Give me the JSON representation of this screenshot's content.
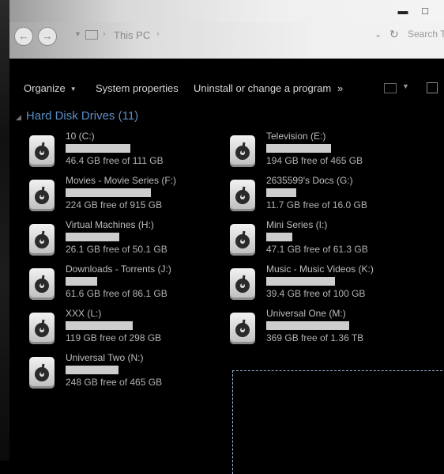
{
  "address": {
    "crumb": "This PC",
    "search_placeholder": "Search This PC"
  },
  "window": {
    "minimize": "▬",
    "maximize": "□"
  },
  "toolbar": {
    "organize": "Organize",
    "system_properties": "System properties",
    "uninstall": "Uninstall or change a program",
    "more": "»"
  },
  "group": {
    "title": "Hard Disk Drives (11)"
  },
  "drives": [
    {
      "name": "10 (C:)",
      "free": "46.4 GB free of 111 GB",
      "fill_fraction": 0.58
    },
    {
      "name": "Television (E:)",
      "free": "194 GB free of 465 GB",
      "fill_fraction": 0.58
    },
    {
      "name": "Movies - Movie Series (F:)",
      "free": "224 GB free of 915 GB",
      "fill_fraction": 0.76
    },
    {
      "name": "2635599's Docs (G:)",
      "free": "11.7 GB free of 16.0 GB",
      "fill_fraction": 0.27
    },
    {
      "name": "Virtual Machines (H:)",
      "free": "26.1 GB free of 50.1 GB",
      "fill_fraction": 0.48
    },
    {
      "name": "Mini Series (I:)",
      "free": "47.1 GB free of 61.3 GB",
      "fill_fraction": 0.23
    },
    {
      "name": "Downloads - Torrents (J:)",
      "free": "61.6 GB free of 86.1 GB",
      "fill_fraction": 0.28
    },
    {
      "name": "Music - Music Videos (K:)",
      "free": "39.4 GB free of 100 GB",
      "fill_fraction": 0.61
    },
    {
      "name": "XXX (L:)",
      "free": "119 GB free of 298 GB",
      "fill_fraction": 0.6
    },
    {
      "name": "Universal One (M:)",
      "free": "369 GB free of 1.36 TB",
      "fill_fraction": 0.74
    },
    {
      "name": "Universal Two (N:)",
      "free": "248 GB free of 465 GB",
      "fill_fraction": 0.47
    }
  ],
  "icons": {
    "back": "back-arrow-icon",
    "forward": "forward-arrow-icon",
    "drive": "hard-drive-icon",
    "refresh": "refresh-icon"
  }
}
